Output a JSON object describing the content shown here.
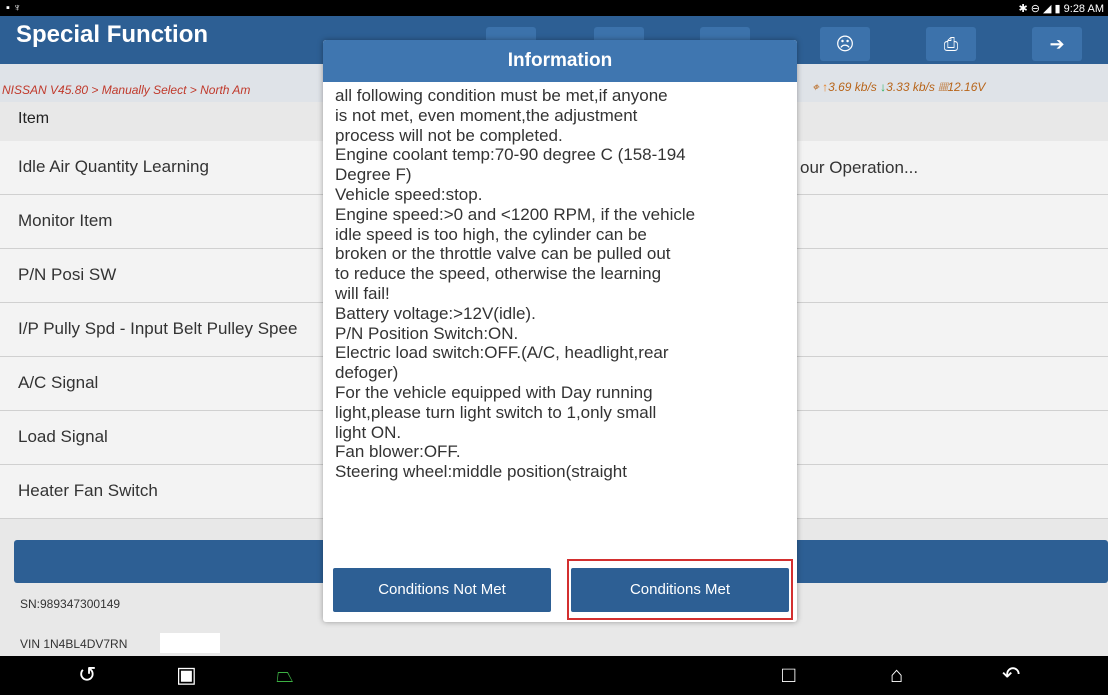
{
  "status_bar": {
    "left_icons": "▪ ♆",
    "right": "✱ ⊖ ◢ ▮ 9:28 AM"
  },
  "header": {
    "title": "Special Function",
    "toolbar": [
      "print-icon",
      "exit-icon",
      "user-icon"
    ]
  },
  "breadcrumb": "NISSAN V45.80 > Manually Select > North Am",
  "network": {
    "upload": "3.69 kb/s",
    "download": "3.33 kb/s",
    "battery": "12.16V"
  },
  "list": {
    "header": "Item",
    "items": [
      "Idle Air Quantity Learning",
      "Monitor Item",
      "P/N Posi SW",
      "I/P Pully Spd - Input Belt Pulley Spee",
      "A/C Signal",
      "Load Signal",
      "Heater Fan Switch"
    ],
    "row_value": "our Operation..."
  },
  "footer": {
    "sn": "SN:989347300149",
    "vin": "VIN 1N4BL4DV7RN"
  },
  "dialog": {
    "title": "Information",
    "lines": [
      "all following condition must be met,if anyone",
      "is not met, even moment,the adjustment",
      "process will not be completed.",
      "Engine coolant temp:70-90 degree C (158-194",
      "Degree F)",
      "Vehicle speed:stop.",
      "Engine speed:>0 and <1200 RPM, if the vehicle",
      "idle speed is too high, the cylinder can be",
      "broken or the throttle valve can be pulled out",
      "to reduce the speed, otherwise the learning",
      "will fail!",
      "Battery voltage:>12V(idle).",
      "P/N Position Switch:ON.",
      "Electric load switch:OFF.(A/C, headlight,rear",
      "defoger)",
      "For the vehicle equipped with Day running",
      "light,please turn light switch to 1,only small",
      "light ON.",
      "Fan blower:OFF.",
      "Steering wheel:middle position(straight"
    ],
    "btn_not_met": "Conditions Not Met",
    "btn_met": "Conditions Met"
  },
  "nav_icons": [
    "home-vci-icon",
    "gallery-icon",
    "vci-icon",
    "recents-icon",
    "home-icon",
    "back-icon"
  ],
  "colors": {
    "primary": "#2d5f94",
    "dialog_header": "#3f76b0",
    "highlight": "#d32f2f",
    "crumb": "#c0392b"
  }
}
